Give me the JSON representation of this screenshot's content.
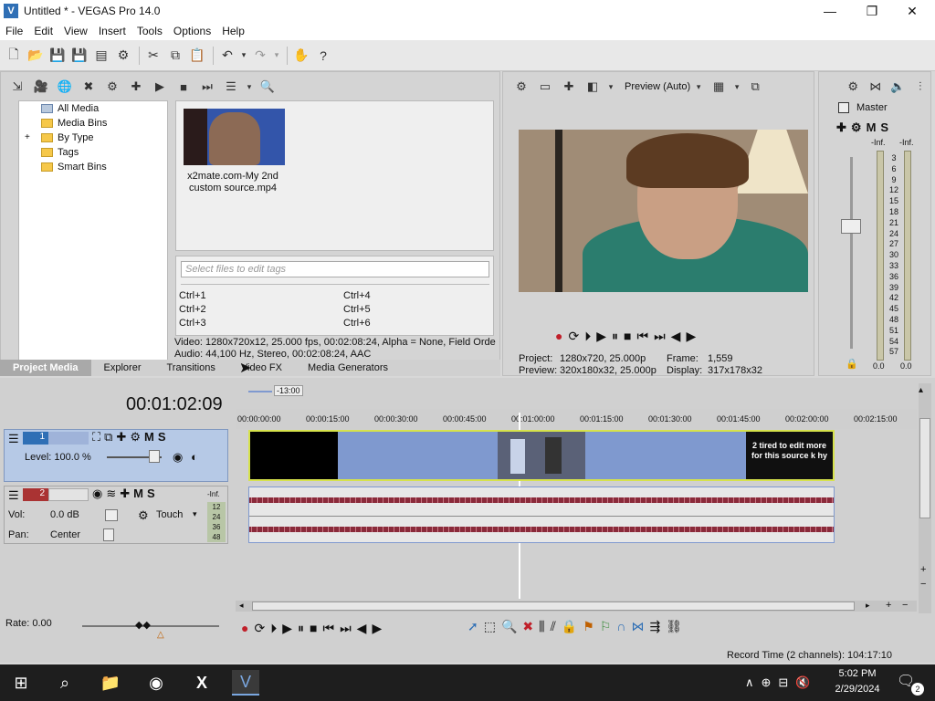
{
  "window": {
    "title": "Untitled * - VEGAS Pro 14.0",
    "minimize": "—",
    "maximize": "❐",
    "close": "✕"
  },
  "menu": [
    "File",
    "Edit",
    "View",
    "Insert",
    "Tools",
    "Options",
    "Help"
  ],
  "media_tree": {
    "items": [
      {
        "label": "All Media"
      },
      {
        "label": "Media Bins"
      },
      {
        "label": "By Type"
      },
      {
        "label": "Tags"
      },
      {
        "label": "Smart Bins"
      }
    ],
    "expand": "+"
  },
  "media_file": {
    "name": "x2mate.com-My 2nd custom source.mp4"
  },
  "tags": {
    "placeholder": "Select files to edit tags",
    "shortcuts": [
      "Ctrl+1",
      "Ctrl+4",
      "Ctrl+2",
      "Ctrl+5",
      "Ctrl+3",
      "Ctrl+6"
    ]
  },
  "media_info": {
    "video": "Video: 1280x720x12, 25.000 fps, 00:02:08:24, Alpha = None, Field Orde",
    "audio": "Audio: 44,100 Hz, Stereo, 00:02:08:24, AAC"
  },
  "tabs": [
    "Project Media",
    "Explorer",
    "Transitions",
    "Video FX",
    "Media Generators"
  ],
  "preview": {
    "mode": "Preview (Auto)",
    "project_label": "Project:",
    "project_value": "1280x720, 25.000p",
    "preview_label": "Preview:",
    "preview_value": "320x180x32, 25.000p",
    "frame_label": "Frame:",
    "frame_value": "1,559",
    "display_label": "Display:",
    "display_value": "317x178x32"
  },
  "master": {
    "label": "Master",
    "inf_left": "-Inf.",
    "inf_right": "-Inf.",
    "scale": [
      "3",
      "6",
      "9",
      "12",
      "15",
      "18",
      "21",
      "24",
      "27",
      "30",
      "33",
      "36",
      "39",
      "42",
      "45",
      "48",
      "51",
      "54",
      "57"
    ],
    "bottom_left": "0.0",
    "bottom_right": "0.0"
  },
  "timeline": {
    "timecode": "00:01:02:09",
    "marker": "-13:00",
    "ruler": [
      "00:00:00:00",
      "00:00:15:00",
      "00:00:30:00",
      "00:00:45:00",
      "00:01:00:00",
      "00:01:15:00",
      "00:01:30:00",
      "00:01:45:00",
      "00:02:00:00",
      "00:02:15:00"
    ],
    "video_track": {
      "number": "1",
      "level": "Level: 100.0 %",
      "m": "M",
      "s": "S"
    },
    "audio_track": {
      "number": "2",
      "vol_label": "Vol:",
      "vol_value": "0.0 dB",
      "pan_label": "Pan:",
      "pan_value": "Center",
      "touch": "Touch",
      "m": "M",
      "s": "S",
      "meter_top": "-Inf.",
      "meter_scale": [
        "12",
        "24",
        "36",
        "48"
      ]
    },
    "clip_text": "2 tired to edit more for this source k hy",
    "rate": "Rate: 0.00",
    "record_time": "Record Time (2 channels): 104:17:10"
  },
  "taskbar": {
    "time": "5:02 PM",
    "date": "2/29/2024",
    "notifications": "2"
  },
  "colors": {
    "accent": "#2f6fb5",
    "video_clip": "#7f99cf",
    "clip_border": "#d6e24c",
    "waveform": "#8a2a3a"
  }
}
